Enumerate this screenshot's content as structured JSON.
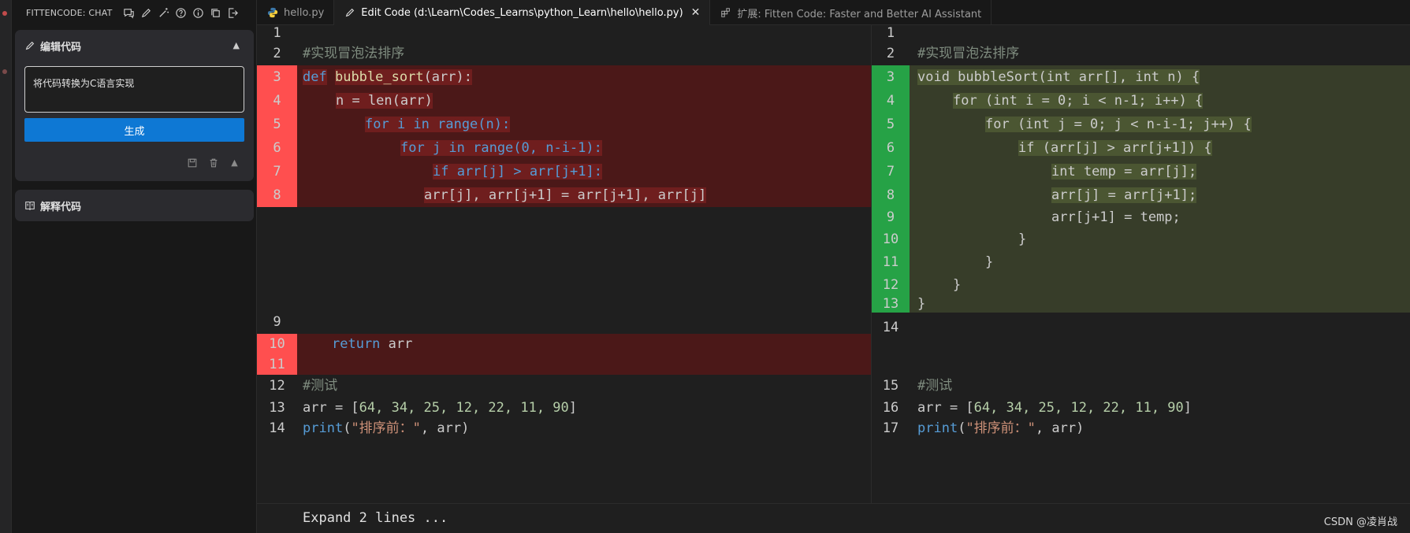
{
  "side": {
    "header_title": "FITTENCODE: CHAT",
    "edit_card": {
      "title": "编辑代码",
      "prompt_text": "将代码转换为C语言实现",
      "generate_label": "生成"
    },
    "explain_card": {
      "title": "解释代码"
    }
  },
  "tabs": [
    {
      "label": "hello.py"
    },
    {
      "label": "Edit Code (d:\\Learn\\Codes_Learns\\python_Learn\\hello\\hello.py)"
    },
    {
      "label": "扩展: Fitten Code: Faster and Better AI Assistant"
    }
  ],
  "left": {
    "lines": [
      "1",
      "2",
      "3",
      "4",
      "5",
      "6",
      "7",
      "8",
      "9",
      "10",
      "11",
      "12",
      "13",
      "14"
    ],
    "code": {
      "l2": "#实现冒泡法排序",
      "l3_def": "def",
      "l3_name": "bubble_sort",
      "l3_rest": "(arr):",
      "l4": "n = len(arr)",
      "l5": "for i in range(n):",
      "l6": "for j in range(0, n-i-1):",
      "l7": "if arr[j] > arr[j+1]:",
      "l8": "arr[j], arr[j+1] = arr[j+1], arr[j]",
      "l10_kw": "return",
      "l10_rest": " arr",
      "l12": "#测试",
      "l13_a": "arr = [",
      "l13_nums": "64, 34, 25, 12, 22, 11, 90",
      "l13_b": "]",
      "l14_fn": "print",
      "l14_str": "\"排序前：\"",
      "l14_rest": ", arr)"
    }
  },
  "right": {
    "lines": [
      "1",
      "2",
      "3",
      "4",
      "5",
      "6",
      "7",
      "8",
      "9",
      "10",
      "11",
      "12",
      "13",
      "14",
      "15",
      "16",
      "17"
    ],
    "code": {
      "l2": "#实现冒泡法排序",
      "l3": "void bubbleSort(int arr[], int n) {",
      "l4": "for (int i = 0; i < n-1; i++) {",
      "l5": "for (int j = 0; j < n-i-1; j++) {",
      "l6": "if (arr[j] > arr[j+1]) {",
      "l7": "int temp = arr[j];",
      "l8": "arr[j] = arr[j+1];",
      "l9": "arr[j+1] = temp;",
      "l10": "}",
      "l11": "}",
      "l12": "}",
      "l13": "}",
      "l15": "#测试",
      "l16_a": "arr = [",
      "l16_nums": "64, 34, 25, 12, 22, 11, 90",
      "l16_b": "]",
      "l17_fn": "print",
      "l17_str": "\"排序前：\"",
      "l17_rest": ", arr)"
    }
  },
  "footer": {
    "expand_label": "Expand 2 lines ...",
    "watermark": "CSDN @凌肖战"
  }
}
